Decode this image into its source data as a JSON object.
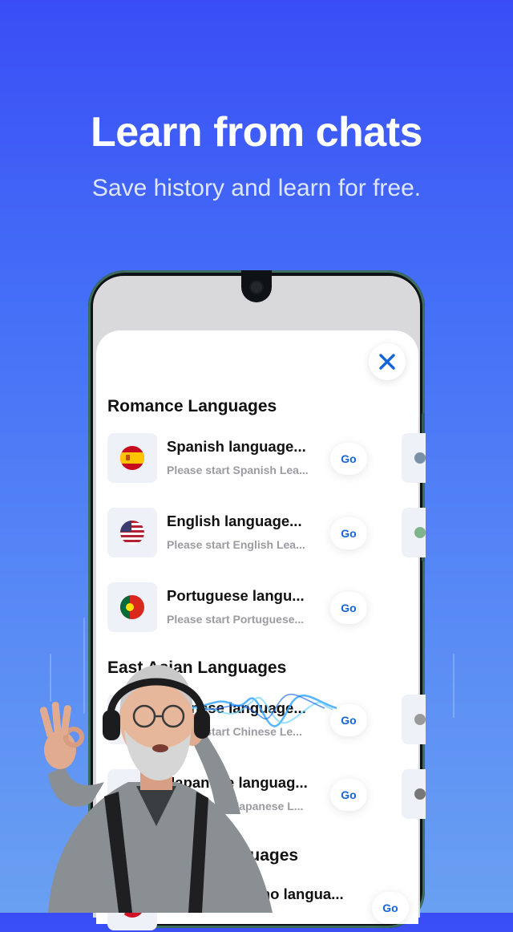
{
  "header": {
    "headline": "Learn from chats",
    "subline": "Save history and learn for free."
  },
  "sheet": {
    "close_icon": "close-icon",
    "sections": [
      {
        "title": "Romance Languages",
        "items": [
          {
            "title": "Spanish language...",
            "subtitle": "Please start Spanish Lea...",
            "button": "Go",
            "flag": "spain-flag-icon"
          },
          {
            "title": "English language...",
            "subtitle": "Please start English Lea...",
            "button": "Go",
            "flag": "usa-flag-icon"
          },
          {
            "title": "Portuguese langu...",
            "subtitle": "Please start Portuguese...",
            "button": "Go",
            "flag": "portugal-flag-icon"
          }
        ]
      },
      {
        "title": "East Asian Languages",
        "items": [
          {
            "title": "Chinese language...",
            "subtitle": "Please start Chinese Le...",
            "button": "Go",
            "flag": "china-flag-icon"
          },
          {
            "title": "Japanese languag...",
            "subtitle": "Please start Japanese L...",
            "button": "Go",
            "flag": "japan-flag-icon"
          }
        ]
      },
      {
        "title": "Austronesic Languages",
        "items": [
          {
            "title": "Tagalog/Filipino langua...",
            "subtitle": "",
            "button": "Go",
            "flag": "philippines-flag-icon"
          }
        ]
      }
    ]
  },
  "colors": {
    "background_top": "#3a4df5",
    "background_bottom": "#6aa0f2",
    "accent_blue": "#1565d8",
    "sheet": "#ffffff"
  }
}
